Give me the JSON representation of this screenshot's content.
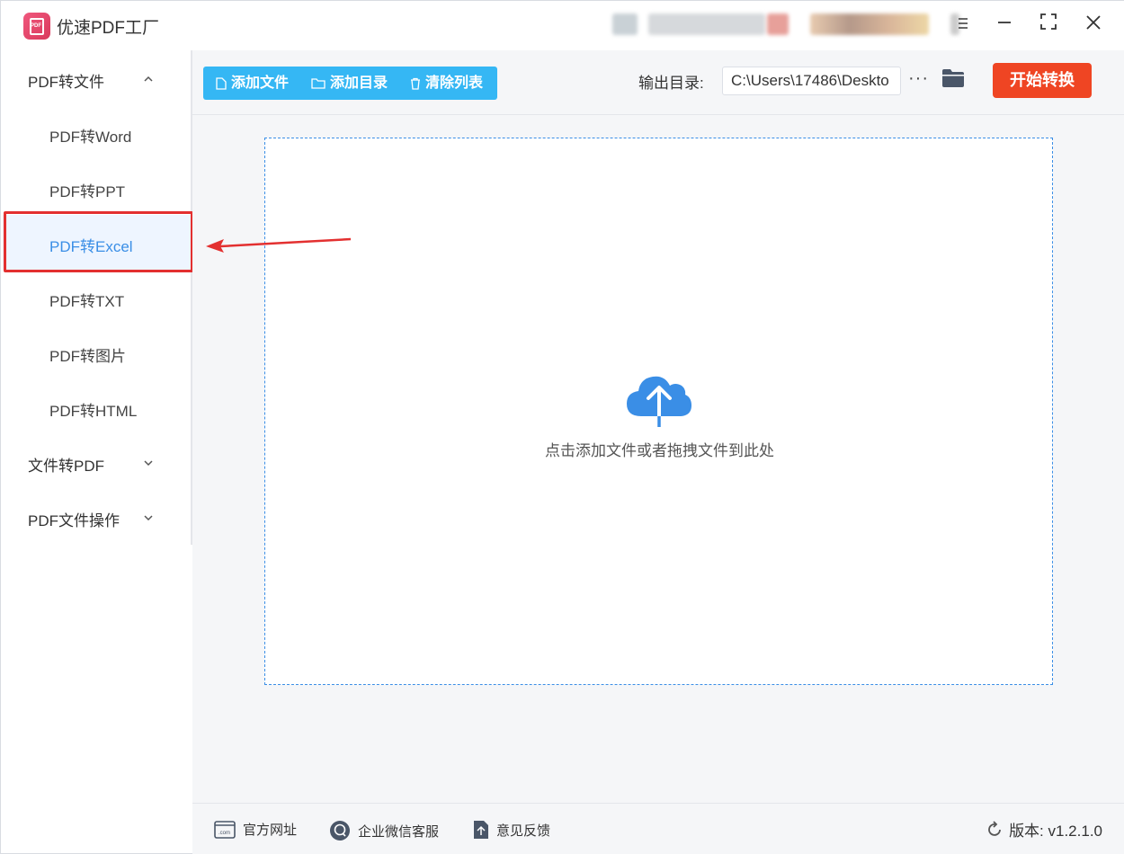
{
  "app": {
    "title": "优速PDF工厂",
    "logo_text": "PDF"
  },
  "window": {
    "menu_icon": "menu-icon",
    "minimize_icon": "minimize-icon",
    "maximize_icon": "maximize-icon",
    "close_icon": "close-icon"
  },
  "sidebar": {
    "categories": [
      {
        "label": "PDF转文件",
        "expanded": true
      },
      {
        "label": "文件转PDF",
        "expanded": false
      },
      {
        "label": "PDF文件操作",
        "expanded": false
      }
    ],
    "items": [
      {
        "label": "PDF转Word"
      },
      {
        "label": "PDF转PPT"
      },
      {
        "label": "PDF转Excel",
        "active": true
      },
      {
        "label": "PDF转TXT"
      },
      {
        "label": "PDF转图片"
      },
      {
        "label": "PDF转HTML"
      }
    ]
  },
  "toolbar": {
    "add_file": "添加文件",
    "add_dir": "添加目录",
    "clear_list": "清除列表",
    "output_label": "输出目录:",
    "output_path": "C:\\Users\\17486\\Deskto",
    "more": "···",
    "start": "开始转换"
  },
  "dropzone": {
    "hint": "点击添加文件或者拖拽文件到此处"
  },
  "footer": {
    "website": "官方网址",
    "wechat": "企业微信客服",
    "feedback": "意见反馈",
    "version": "版本: v1.2.1.0"
  },
  "colors": {
    "accent": "#3a8ee6",
    "toolbar_blue": "#35b7f4",
    "start_red": "#ef4523",
    "highlight": "#e33030"
  }
}
